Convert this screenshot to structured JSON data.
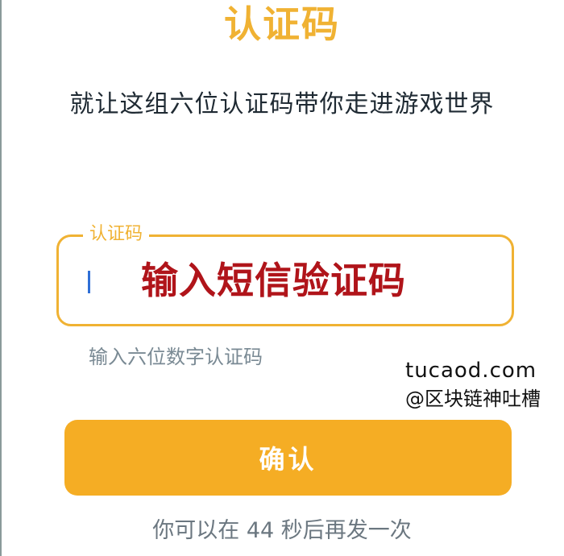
{
  "header": {
    "title": "认证码",
    "subtitle": "就让这组六位认证码带你走进游戏世界"
  },
  "code_field": {
    "label": "认证码",
    "overlay_text": "输入短信验证码",
    "hint": "输入六位数字认证码"
  },
  "watermark": {
    "site": "tucaod.com",
    "author": "@区块链神吐槽"
  },
  "confirm_button": {
    "label": "确认"
  },
  "resend": {
    "text": "你可以在 44 秒后再发一次"
  },
  "colors": {
    "accent": "#f0b233",
    "button": "#f5ad24",
    "overlay_red": "#b0141a",
    "caret_blue": "#2f6fd6"
  }
}
